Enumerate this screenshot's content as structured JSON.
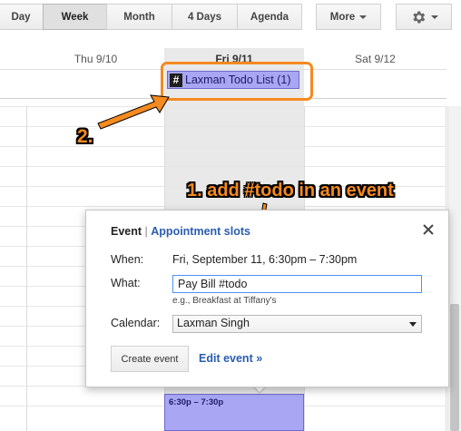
{
  "toolbar": {
    "view_buttons": [
      "Day",
      "Week",
      "Month",
      "4 Days",
      "Agenda"
    ],
    "active_view": "Week",
    "more_label": "More",
    "settings_icon": "gear-icon"
  },
  "day_headers": [
    "Thu 9/10",
    "Fri 9/11",
    "Sat 9/12"
  ],
  "all_day": {
    "todo_chip": {
      "icon": "hash-icon",
      "icon_text": "#",
      "label": "Laxman Todo List (1)"
    }
  },
  "annotations": {
    "step1": "1. add #todo in an event",
    "step2": "2."
  },
  "popup": {
    "tab_event": "Event",
    "separator": "|",
    "tab_appointment": "Appointment slots",
    "close_icon": "close-icon",
    "when_label": "When:",
    "when_value": "Fri, September 11, 6:30pm – 7:30pm",
    "what_label": "What:",
    "what_value": "Pay Bill #todo",
    "what_hint": "e.g., Breakfast at Tiffany's",
    "calendar_label": "Calendar:",
    "calendar_value": "Laxman Singh",
    "create_button": "Create event",
    "edit_link": "Edit event »"
  },
  "event_block": {
    "time": "6:30p – 7:30p"
  },
  "colors": {
    "accent": "#f58a1f",
    "event": "#a9a6f4",
    "link": "#2a5db0"
  }
}
